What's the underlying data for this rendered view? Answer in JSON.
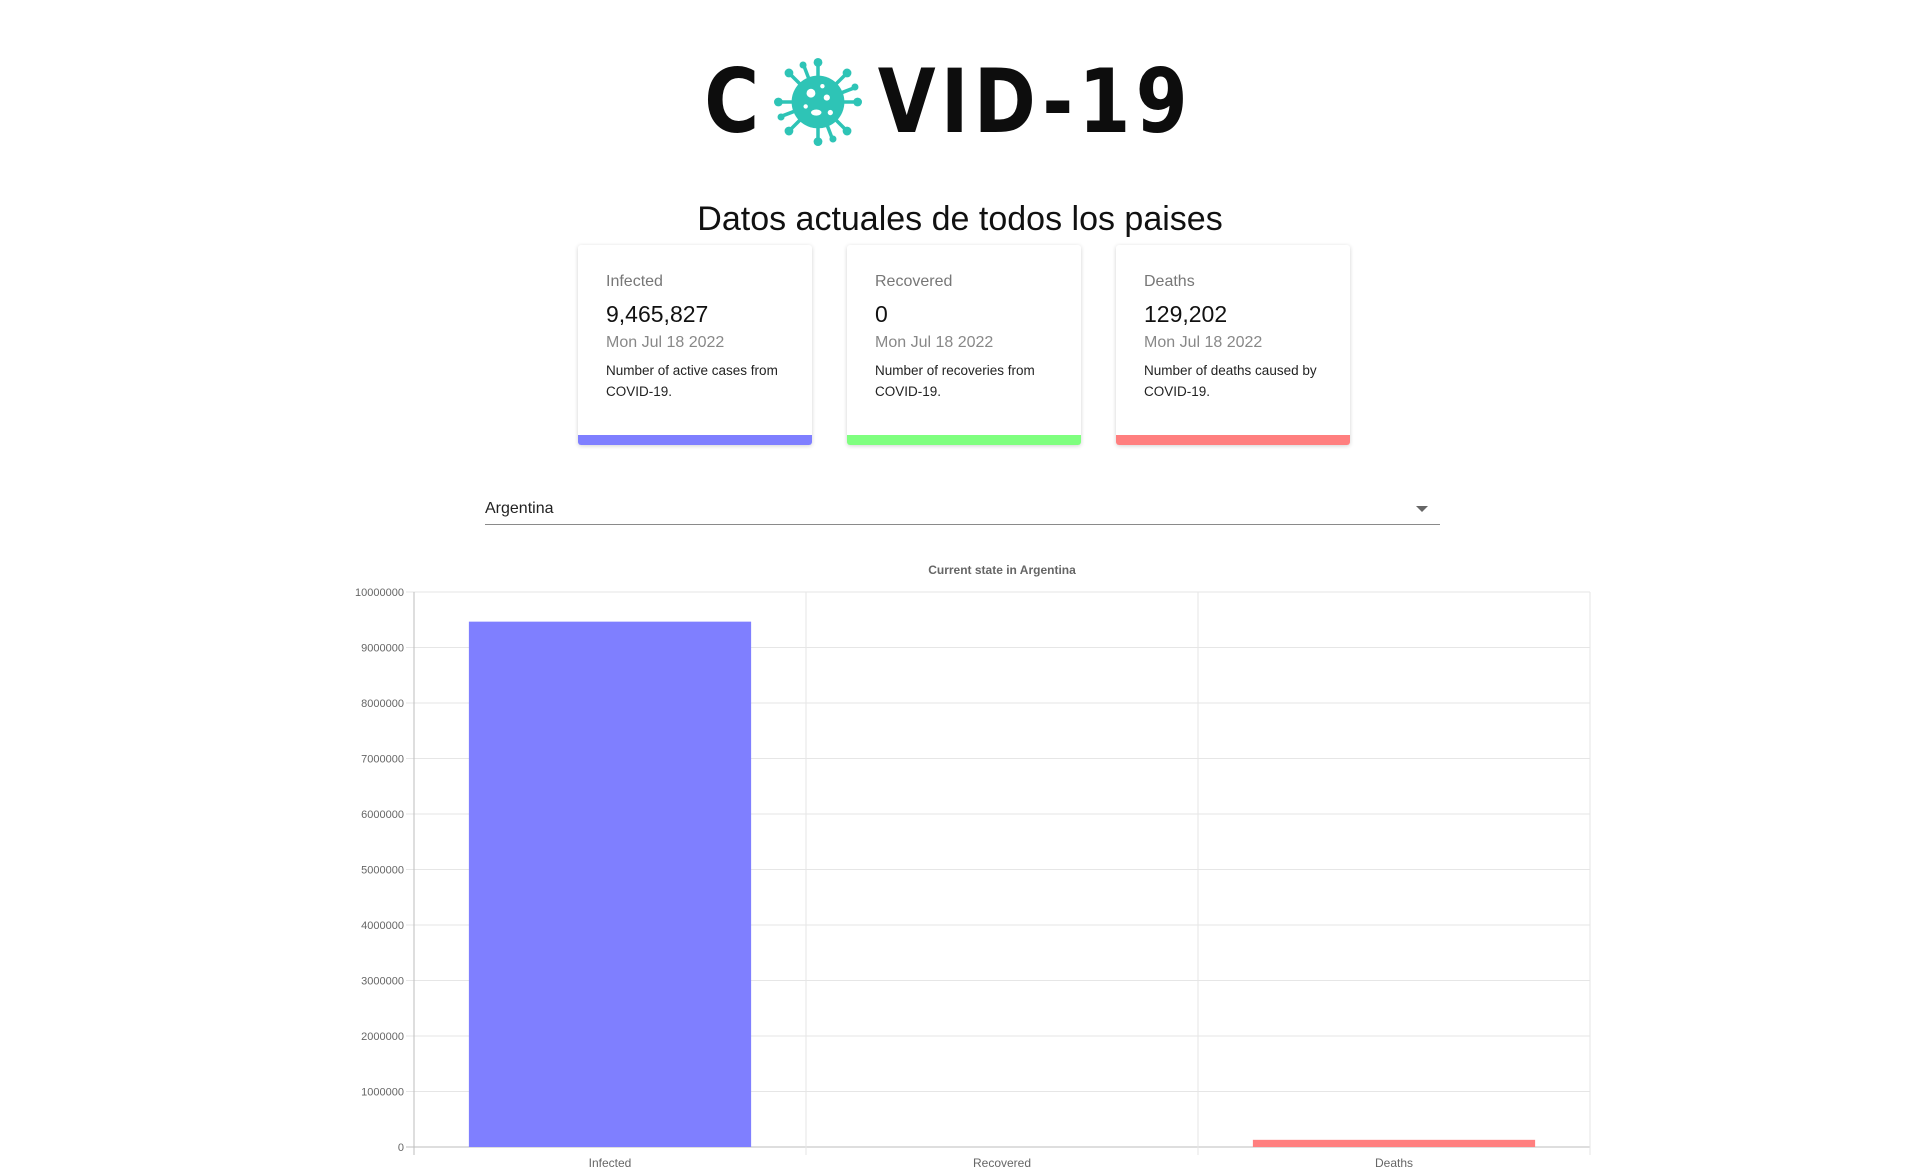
{
  "logo": {
    "text_before": "C",
    "text_after": "VID-19",
    "icon": "virus-icon",
    "icon_color": "#2ec4b6"
  },
  "page_title": "Datos actuales de todos los paises",
  "cards": [
    {
      "label": "Infected",
      "value": "9,465,827",
      "date": "Mon Jul 18 2022",
      "description": "Number of active cases from COVID-19.",
      "color": "#7f7fff"
    },
    {
      "label": "Recovered",
      "value": "0",
      "date": "Mon Jul 18 2022",
      "description": "Number of recoveries from COVID-19.",
      "color": "#7fff7f"
    },
    {
      "label": "Deaths",
      "value": "129,202",
      "date": "Mon Jul 18 2022",
      "description": "Number of deaths caused by COVID-19.",
      "color": "#ff7f7f"
    }
  ],
  "country_select": {
    "selected": "Argentina"
  },
  "chart_data": {
    "type": "bar",
    "title": "Current state in Argentina",
    "categories": [
      "Infected",
      "Recovered",
      "Deaths"
    ],
    "values": [
      9465827,
      0,
      129202
    ],
    "colors": [
      "#7f7fff",
      "#7fff7f",
      "#ff7f7f"
    ],
    "ylim": [
      0,
      10000000
    ],
    "yticks": [
      "0",
      "1000000",
      "2000000",
      "3000000",
      "4000000",
      "5000000",
      "6000000",
      "7000000",
      "8000000",
      "9000000",
      "10000000"
    ],
    "xlabel": "",
    "ylabel": "",
    "grid": true,
    "legend": false
  }
}
